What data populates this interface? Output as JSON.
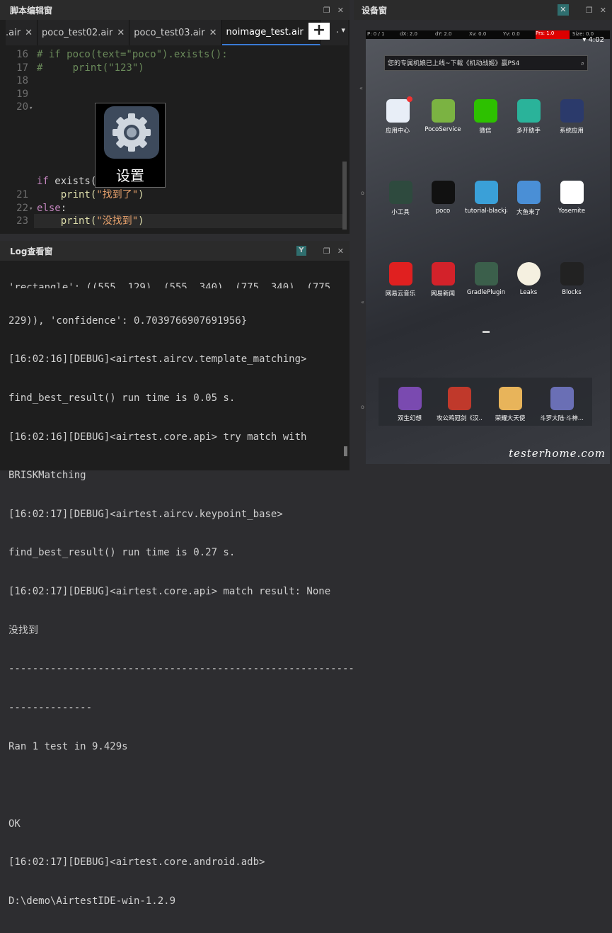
{
  "script_panel": {
    "title": "脚本编辑窗",
    "tabs": [
      {
        "label": ".air",
        "close": "✕"
      },
      {
        "label": "poco_test02.air",
        "close": "✕"
      },
      {
        "label": "poco_test03.air",
        "close": "✕"
      },
      {
        "label": "noimage_test.air",
        "close": "✕"
      }
    ],
    "tab_dot": "•",
    "tab_dot2": "·",
    "plus_label": "+",
    "dropdown": "▾",
    "code_lines": [
      {
        "num": "16",
        "text": "# if poco(text=\"poco\").exists():"
      },
      {
        "num": "17",
        "text": "#     print(\"123\")"
      },
      {
        "num": "18",
        "text": ""
      },
      {
        "num": "19",
        "text": ""
      },
      {
        "num": "20",
        "text": ""
      },
      {
        "num": "",
        "text_kw": "if",
        "text_fn": " exists(",
        "text_end": "):"
      },
      {
        "num": "21",
        "text_fn": "    print(",
        "text_str": "\"找到了\"",
        "text_end": ")"
      },
      {
        "num": "22",
        "text_kw": "else",
        "text_end": ":"
      },
      {
        "num": "23",
        "text_fn": "    print(",
        "text_str": "\"没找到\"",
        "text_end": ")"
      }
    ],
    "tooltip_label": "设置"
  },
  "log_panel": {
    "title": "Log查看窗",
    "lines": [
      "'rectangle': ((555, 129), (555, 340), (775, 340), (775,",
      "229)), 'confidence': 0.7039766907691956}",
      "[16:02:16][DEBUG]<airtest.aircv.template_matching>",
      "find_best_result() run time is 0.05 s.",
      "[16:02:16][DEBUG]<airtest.core.api> try match with",
      "BRISKMatching",
      "[16:02:17][DEBUG]<airtest.aircv.keypoint_base>",
      "find_best_result() run time is 0.27 s.",
      "[16:02:17][DEBUG]<airtest.core.api> match result: None",
      "没找到",
      "----------------------------------------------------------",
      "--------------",
      "Ran 1 test in 9.429s",
      "",
      "OK",
      "[16:02:17][DEBUG]<airtest.core.android.adb>",
      "D:\\demo\\AirtestIDE-win-1.2.9"
    ]
  },
  "device_panel": {
    "title": "设备窗",
    "status_bar": {
      "p": "P: 0 / 1",
      "dx": "dX: 2.0",
      "dy": "dY: 2.0",
      "xv": "Xv: 0.0",
      "yv": "Yv: 0.0",
      "prs": "Prs: 1.0",
      "size": "Size: 0.0"
    },
    "time": "4:02",
    "search_text": "您的专属机娘已上线~下载《机动战姬》赢PS4",
    "apps": [
      {
        "label": "应用中心",
        "color": "#e8eef7"
      },
      {
        "label": "PocoService",
        "color": "#7bb342"
      },
      {
        "label": "微信",
        "color": "#2dc100"
      },
      {
        "label": "多开助手",
        "color": "#2ab39a"
      },
      {
        "label": "系统应用",
        "color": "#2b3a6b"
      },
      {
        "label": "小工具",
        "color": "#2e4a3e"
      },
      {
        "label": "poco",
        "color": "#111111"
      },
      {
        "label": "tutorial-blackja...",
        "color": "#3aa0d8"
      },
      {
        "label": "大鱼来了",
        "color": "#4a8fd6"
      },
      {
        "label": "Yosemite",
        "color": "#ffffff"
      },
      {
        "label": "网易云音乐",
        "color": "#e02020"
      },
      {
        "label": "网易新闻",
        "color": "#d3222a"
      },
      {
        "label": "GradlePlugin",
        "color": "#3b5f4b"
      },
      {
        "label": "Leaks",
        "color": "#f5f0e0"
      },
      {
        "label": "Blocks",
        "color": "#222222"
      }
    ],
    "dock_apps": [
      {
        "label": "双生幻想",
        "color": "#7a4ab0"
      },
      {
        "label": "攻公鸡冠剑《汉...",
        "color": "#c0392b"
      },
      {
        "label": "荣耀大天使",
        "color": "#e8b45a"
      },
      {
        "label": "斗罗大陆·斗神...",
        "color": "#6a6fb5"
      }
    ],
    "watermark": "testerhome.com"
  }
}
